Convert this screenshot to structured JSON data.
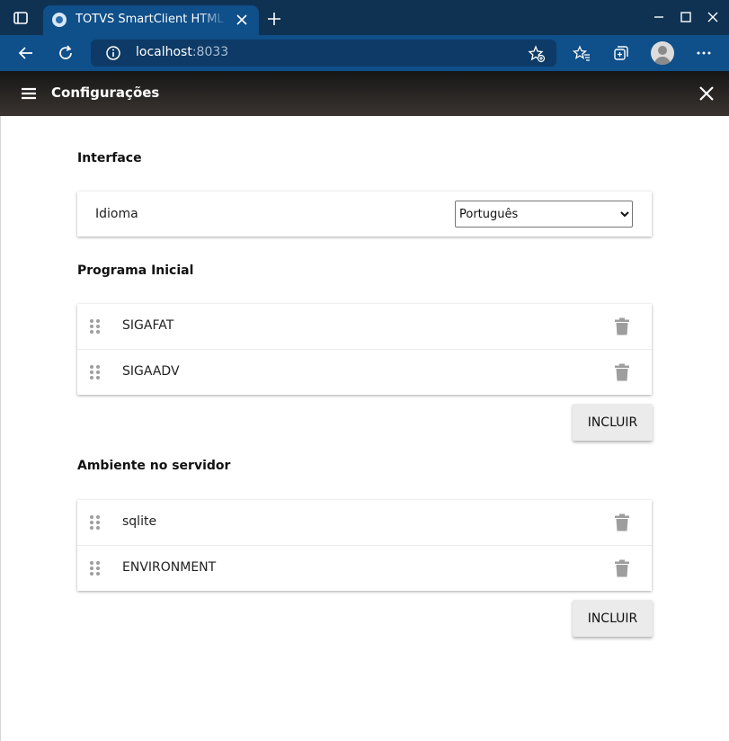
{
  "browser": {
    "tab_title": "TOTVS SmartClient HTML - Página",
    "url_host": "localhost",
    "url_port": ":8033"
  },
  "header": {
    "title": "Configurações"
  },
  "interface": {
    "title": "Interface",
    "language_label": "Idioma",
    "language_value": "Português"
  },
  "programa_inicial": {
    "title": "Programa Inicial",
    "items": [
      {
        "label": "SIGAFAT"
      },
      {
        "label": "SIGAADV"
      }
    ],
    "add_label": "INCLUIR"
  },
  "ambiente": {
    "title": "Ambiente no servidor",
    "items": [
      {
        "label": "sqlite"
      },
      {
        "label": "ENVIRONMENT"
      }
    ],
    "add_label": "INCLUIR"
  },
  "colors": {
    "tabbar": "#0f3253",
    "navbar": "#0f4f8a",
    "header_dark": "#1c1a19",
    "button_bg": "#ebebeb",
    "icon_gray": "#9e9e9e"
  }
}
